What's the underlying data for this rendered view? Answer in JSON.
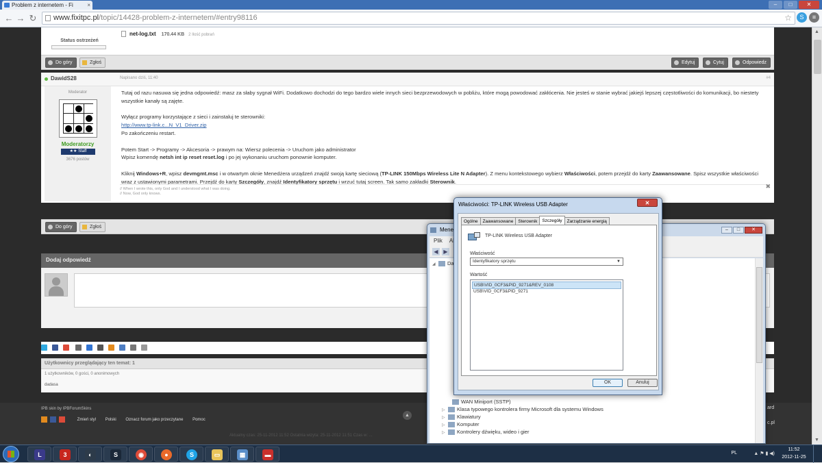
{
  "browser": {
    "tab_title": "Problem z internetem - Fi",
    "tab_close": "×",
    "url_lead": "www.fixitpc.pl",
    "url_rest": "/topic/14428-problem-z-internetem/#entry98116",
    "back": "←",
    "forward": "→",
    "reload": "↻",
    "star": "☆",
    "window_controls": {
      "minimize": "–",
      "maximize": "□",
      "close": "✕"
    }
  },
  "previous_post": {
    "status_label": "Status ostrzeżeń",
    "attachment_name": "net-log.txt",
    "attachment_size": "170.44 KB",
    "attachment_downloads": "2 Ilość pobrań",
    "buttons": {
      "up": "Do góry",
      "report": "Zgłoś",
      "edit": "Edytuj",
      "quote": "Cytuj",
      "reply": "Odpowiedz"
    }
  },
  "post": {
    "author": "DawidS28",
    "date": "Napisano dziś, 11:40",
    "number": "#4",
    "role": "Moderator",
    "group": "Moderatorzy",
    "staff_badge": "★★    Staff",
    "posts_count": "3676 postów",
    "paragraphs": {
      "p1": "Tutaj od razu nasuwa się jedna odpowiedź: masz za słaby sygnał WiFi. Dodatkowo dochodzi do tego bardzo wiele innych sieci bezprzewodowych w pobliżu, które mogą powodować zakłócenia. Nie jesteś w stanie wybrać jakiejś lepszej częstotliwości do komunikacji, bo niestety wszystkie kanały są zajęte.",
      "p2_line1": "Wyłącz programy korzystające z sieci i zainstaluj te sterowniki:",
      "p2_link": "http://www.tp-link.c...N_V1_Driver.zip",
      "p2_line3": "Po zakończeniu restart.",
      "p3_line1": "Potem Start -> Programy -> Akcesoria -> prawym na: Wiersz polecenia -> Uruchom jako administrator",
      "p3_pre": "Wpisz komendę ",
      "p3_cmd": "netsh int ip reset reset.log",
      "p3_post": " i po jej wykonaniu uruchom ponownie komputer.",
      "p4_a": "Kliknij ",
      "p4_b": "Windows+R",
      "p4_c": ", wpisz ",
      "p4_d": "devmgmt.msc",
      "p4_e": " i w otwartym oknie Menedżera urządzeń znajdź swoją kartę sieciową (",
      "p4_f": "TP-LINK 150Mbps Wireless Lite N Adapter",
      "p4_g": "). Z menu kontekstowego wybierz ",
      "p4_h": "Właściwości",
      "p4_i": ", potem przejdź do karty ",
      "p4_j": "Zaawansowane",
      "p4_k": ". Spisz wszystkie właściwości wraz z ustawionymi parametrami. Przejdź do karty ",
      "p4_l": "Szczegóły",
      "p4_m": ", znajdź ",
      "p4_n": "Identyfikatory sprzętu",
      "p4_o": " i wrzuć tutaj screen. Tak samo zakładki ",
      "p4_p": "Sterownik",
      "p4_q": "."
    },
    "signature_1": "// When I wrote this, only God and I understood what I was doing.",
    "signature_2": "// Now, God only knows.",
    "close_x": "✖",
    "buttons": {
      "up": "Do góry",
      "report": "Zgłoś"
    }
  },
  "reply": {
    "header": "Dodaj odpowiedź"
  },
  "viewers": {
    "header": "Użytkownicy przeglądający ten temat: 1",
    "counts": "1 użytkowników, 0 gości, 0 anonimowych",
    "name": "dadasa"
  },
  "footer": {
    "credit": "IPB skin by IPBForumSkins",
    "links": {
      "style": "Zmień styl",
      "lang": "Polski",
      "mark": "Oznacz forum jako przeczytane",
      "help": "Pomoc"
    },
    "totop": "▲",
    "dim_text": "Aktualny czas: 25-11-2012 11:52      Ostatnia wizyta: 25-11-2012 11:51      Czas w: ...",
    "right1": "ard",
    "right2": "c.pl"
  },
  "device_manager": {
    "title": "Menedż",
    "menu": {
      "file": "Plik",
      "action": "Ak"
    },
    "tree": {
      "root": "Da",
      "wan": "WAN Miniport (SSTP)",
      "usb_class": "Klasa typowego kontrolera firmy Microsoft dla systemu Windows",
      "keyboards": "Klawiatury",
      "computer": "Komputer",
      "audio": "Kontrolery dźwięku, wideo i gier"
    }
  },
  "properties_dialog": {
    "title": "Właściwości: TP-LINK Wireless USB Adapter",
    "close": "✕",
    "tabs": [
      "Ogólne",
      "Zaawansowane",
      "Sterownik",
      "Szczegóły",
      "Zarządzanie energią"
    ],
    "active_tab": "Szczegóły",
    "device_name": "TP-LINK Wireless USB Adapter",
    "property_label": "Właściwość",
    "property_value": "Identyfikatory sprzętu",
    "value_label": "Wartość",
    "values": [
      "USB\\VID_0CF3&PID_9271&REV_0108",
      "USB\\VID_0CF3&PID_9271"
    ],
    "ok": "OK",
    "cancel": "Anuluj"
  },
  "taskbar": {
    "lang": "PL",
    "time": "11:52",
    "date": "2012-11-25",
    "tray_icons": "▲  ⚑  ▮  ◀)"
  }
}
